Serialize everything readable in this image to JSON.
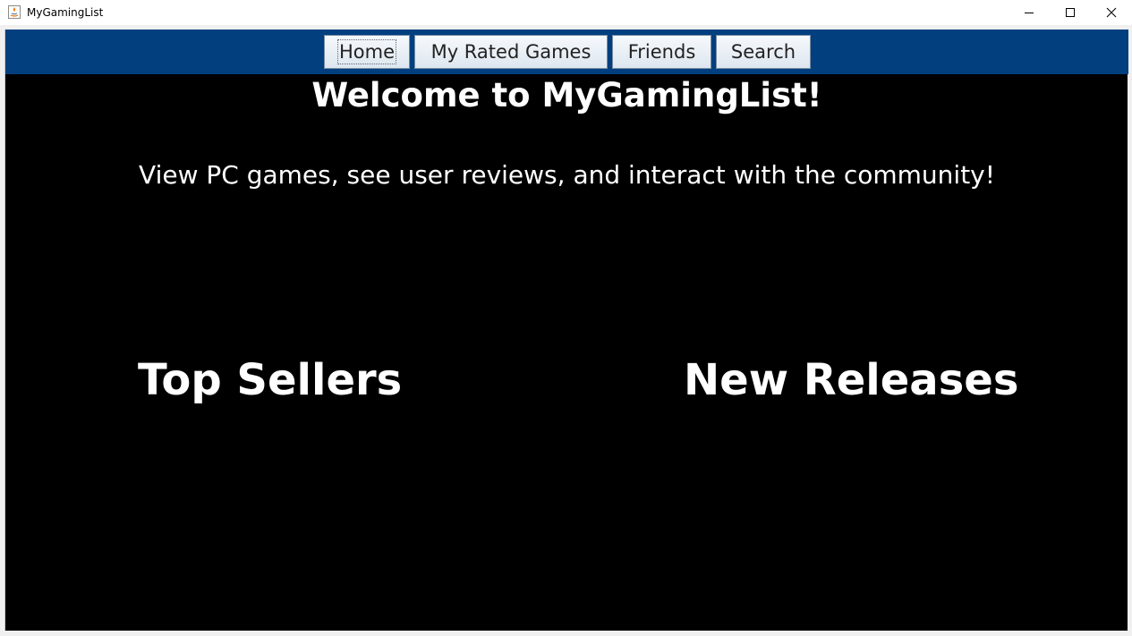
{
  "window": {
    "title": "MyGamingList",
    "controls": {
      "minimize_icon": "minimize-icon",
      "maximize_icon": "maximize-icon",
      "close_icon": "close-icon"
    }
  },
  "nav": {
    "background_color": "#013f7f",
    "buttons": [
      {
        "label": "Home",
        "focused": true
      },
      {
        "label": "My Rated Games",
        "focused": false
      },
      {
        "label": "Friends",
        "focused": false
      },
      {
        "label": "Search",
        "focused": false
      }
    ]
  },
  "main": {
    "background_color": "#000000",
    "welcome": "Welcome to MyGamingList!",
    "subtitle": "View PC games, see user reviews, and interact with the community!",
    "sections": [
      {
        "heading": "Top Sellers"
      },
      {
        "heading": "New Releases"
      }
    ]
  }
}
